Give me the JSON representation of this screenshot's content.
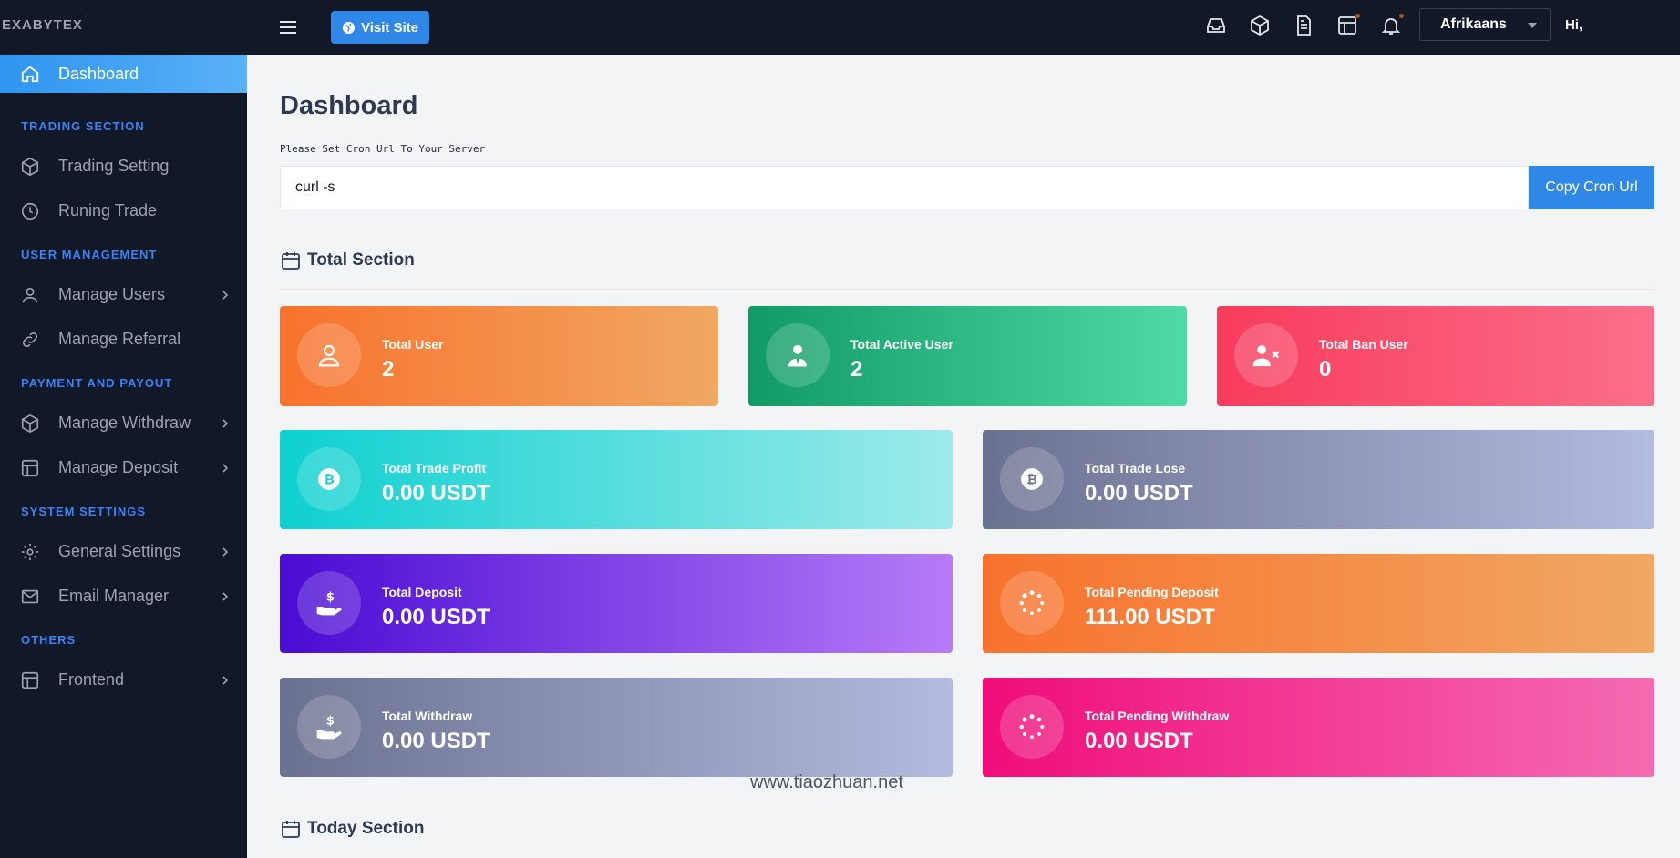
{
  "brand": "EXABYTEX",
  "sidebar": {
    "active": {
      "label": "Dashboard",
      "icon": "home-icon"
    },
    "sections": [
      {
        "title": "TRADING SECTION",
        "items": [
          {
            "label": "Trading Setting",
            "icon": "cube-icon",
            "chevron": false
          },
          {
            "label": "Runing Trade",
            "icon": "clock-icon",
            "chevron": false
          }
        ]
      },
      {
        "title": "USER MANAGEMENT",
        "items": [
          {
            "label": "Manage Users",
            "icon": "user-icon",
            "chevron": true
          },
          {
            "label": "Manage Referral",
            "icon": "link-icon",
            "chevron": false
          }
        ]
      },
      {
        "title": "PAYMENT AND PAYOUT",
        "items": [
          {
            "label": "Manage Withdraw",
            "icon": "cube-icon",
            "chevron": true
          },
          {
            "label": "Manage Deposit",
            "icon": "table-icon",
            "chevron": true
          }
        ]
      },
      {
        "title": "SYSTEM SETTINGS",
        "items": [
          {
            "label": "General Settings",
            "icon": "gear-icon",
            "chevron": true
          },
          {
            "label": "Email Manager",
            "icon": "mail-icon",
            "chevron": true
          }
        ]
      },
      {
        "title": "OTHERS",
        "items": [
          {
            "label": "Frontend",
            "icon": "table-icon",
            "chevron": true
          }
        ]
      }
    ]
  },
  "topbar": {
    "visit_site": "Visit Site",
    "language": "Afrikaans",
    "greeting": "Hi,",
    "icons": [
      "inbox-icon",
      "cube-icon",
      "document-icon",
      "table-icon",
      "bell-icon"
    ]
  },
  "main": {
    "title": "Dashboard",
    "cron_label": "Please Set Cron Url To Your Server",
    "cron_value": "curl -s",
    "copy_button": "Copy Cron Url",
    "total_section": "Total Section",
    "today_section": "Today Section",
    "cards": {
      "total_user": {
        "title": "Total User",
        "value": "2"
      },
      "total_active_user": {
        "title": "Total Active User",
        "value": "2"
      },
      "total_ban_user": {
        "title": "Total Ban User",
        "value": "0"
      },
      "total_trade_profit": {
        "title": "Total Trade Profit",
        "value": "0.00 USDT"
      },
      "total_trade_lose": {
        "title": "Total Trade Lose",
        "value": "0.00 USDT"
      },
      "total_deposit": {
        "title": "Total Deposit",
        "value": "0.00 USDT"
      },
      "total_pending_deposit": {
        "title": "Total Pending Deposit",
        "value": "111.00 USDT"
      },
      "total_withdraw": {
        "title": "Total Withdraw",
        "value": "0.00 USDT"
      },
      "total_pending_withdraw": {
        "title": "Total Pending Withdraw",
        "value": "0.00 USDT"
      }
    }
  },
  "watermark": "www.tiaozhuan.net",
  "colors": {
    "accent": "#2f87e8",
    "sidebar_bg": "#111827",
    "sidebar_section": "#3b82f6"
  }
}
